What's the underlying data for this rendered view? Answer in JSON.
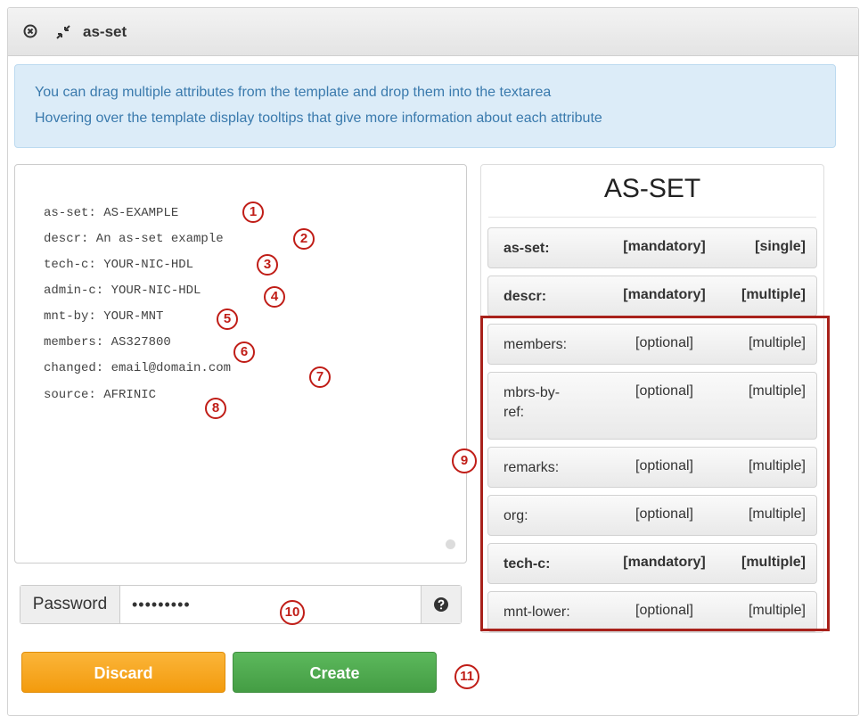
{
  "window": {
    "title": "as-set"
  },
  "info": {
    "line1": "You can drag multiple attributes from the template and drop them into the textarea",
    "line2": "Hovering over the template display tooltips that give more information about each attribute"
  },
  "editor": {
    "lines": [
      "as-set: AS-EXAMPLE",
      "descr: An as-set example",
      "tech-c: YOUR-NIC-HDL",
      "admin-c: YOUR-NIC-HDL",
      "mnt-by: YOUR-MNT",
      "members: AS327800",
      "changed: email@domain.com",
      "source: AFRINIC"
    ]
  },
  "password": {
    "label": "Password",
    "value": "•••••••••"
  },
  "buttons": {
    "discard": "Discard",
    "create": "Create"
  },
  "template": {
    "title": "AS-SET",
    "attributes": [
      {
        "name": "as-set:",
        "requirement": "[mandatory]",
        "cardinality": "[single]"
      },
      {
        "name": "descr:",
        "requirement": "[mandatory]",
        "cardinality": "[multiple]"
      },
      {
        "name": "members:",
        "requirement": "[optional]",
        "cardinality": "[multiple]"
      },
      {
        "name": "mbrs-by-ref:",
        "requirement": "[optional]",
        "cardinality": "[multiple]"
      },
      {
        "name": "remarks:",
        "requirement": "[optional]",
        "cardinality": "[multiple]"
      },
      {
        "name": "org:",
        "requirement": "[optional]",
        "cardinality": "[multiple]"
      },
      {
        "name": "tech-c:",
        "requirement": "[mandatory]",
        "cardinality": "[multiple]"
      },
      {
        "name": "mnt-lower:",
        "requirement": "[optional]",
        "cardinality": "[multiple]"
      }
    ]
  },
  "markers": [
    "1",
    "2",
    "3",
    "4",
    "5",
    "6",
    "7",
    "8",
    "9",
    "10",
    "11"
  ],
  "colors": {
    "marker": "#c01d17",
    "discard": "#f39b0d",
    "create": "#449d44",
    "info_text": "#3a7aad"
  }
}
